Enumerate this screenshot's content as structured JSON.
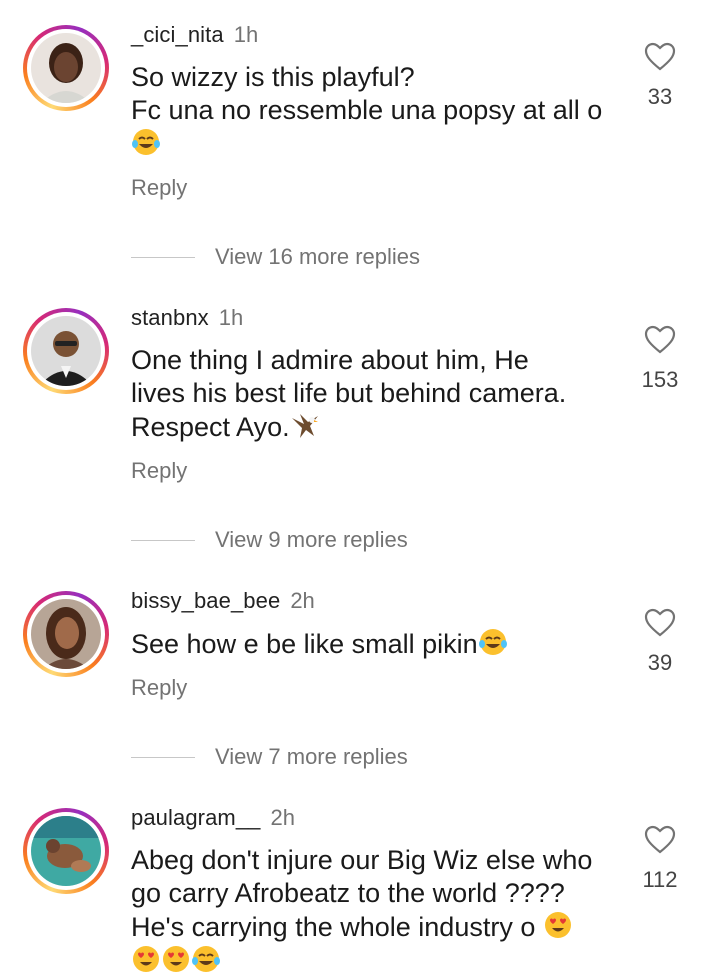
{
  "reply_label": "Reply",
  "comments": [
    {
      "username": "_cici_nita",
      "time": "1h",
      "lines": [
        "So wizzy is this playful?",
        "Fc una no ressemble una popsy at all o",
        ""
      ],
      "likes": "33",
      "view_more": "View 16 more replies"
    },
    {
      "username": "stanbnx",
      "time": "1h",
      "lines": [
        "One thing I admire about him, He",
        "lives his best life but behind camera.",
        "Respect Ayo."
      ],
      "likes": "153",
      "view_more": "View 9 more replies"
    },
    {
      "username": "bissy_bae_bee",
      "time": "2h",
      "lines": [
        "See how e be like small pikin"
      ],
      "likes": "39",
      "view_more": "View 7 more replies"
    },
    {
      "username": "paulagram__",
      "time": "2h",
      "lines": [
        "Abeg don't injure our Big Wiz else who",
        "go carry Afrobeatz to the world ????",
        "He's carrying the whole industry o",
        ""
      ],
      "likes": "112"
    }
  ],
  "colors": {
    "ring": [
      "#feda75",
      "#fa7e1e",
      "#d62976",
      "#962fbf"
    ],
    "muted": "#737373"
  },
  "icons": {
    "like": "heart-outline-icon",
    "laugh": "tears-of-joy-emoji",
    "love": "heart-eyes-emoji",
    "eagle": "eagle-emoji"
  }
}
